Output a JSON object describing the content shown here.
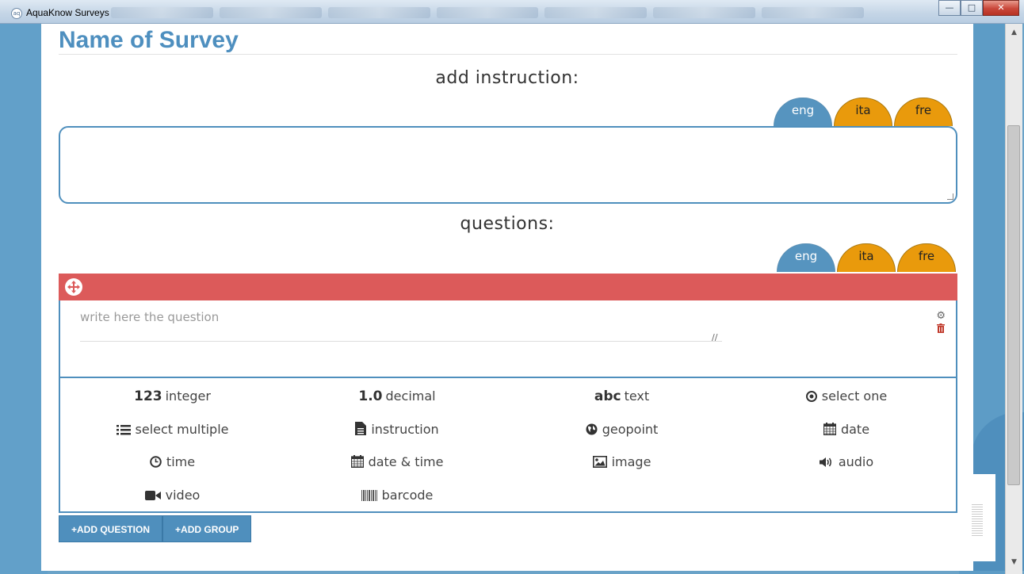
{
  "window": {
    "title": "AquaKnow Surveys"
  },
  "page": {
    "title": "Name of Survey",
    "instruction_heading": "add instruction:",
    "questions_heading": "questions:",
    "languages": [
      {
        "code": "eng",
        "active": true
      },
      {
        "code": "ita",
        "active": false
      },
      {
        "code": "fre",
        "active": false
      }
    ],
    "instruction_value": "",
    "question_placeholder": "write here the question",
    "colors": {
      "accent": "#4f8fbd",
      "question_bar": "#dc5a5a",
      "lang_inactive": "#e99a0c"
    }
  },
  "question_types": [
    {
      "glyph": "123",
      "label": "integer",
      "icon": ""
    },
    {
      "glyph": "1.0",
      "label": "decimal",
      "icon": ""
    },
    {
      "glyph": "abc",
      "label": "text",
      "icon": ""
    },
    {
      "glyph": "",
      "label": "select one",
      "icon": "radio-icon"
    },
    {
      "glyph": "",
      "label": "select multiple",
      "icon": "list-icon"
    },
    {
      "glyph": "",
      "label": "instruction",
      "icon": "file-icon"
    },
    {
      "glyph": "",
      "label": "geopoint",
      "icon": "globe-icon"
    },
    {
      "glyph": "",
      "label": "date",
      "icon": "calendar-icon"
    },
    {
      "glyph": "",
      "label": "time",
      "icon": "clock-icon"
    },
    {
      "glyph": "",
      "label": "date & time",
      "icon": "calendar-icon"
    },
    {
      "glyph": "",
      "label": "image",
      "icon": "picture-icon"
    },
    {
      "glyph": "",
      "label": "audio",
      "icon": "volume-icon"
    },
    {
      "glyph": "",
      "label": "video",
      "icon": "video-camera-icon"
    },
    {
      "glyph": "",
      "label": "barcode",
      "icon": "barcode-icon"
    }
  ],
  "buttons": {
    "add_question": "+ADD QUESTION",
    "add_group": "+ADD GROUP"
  }
}
